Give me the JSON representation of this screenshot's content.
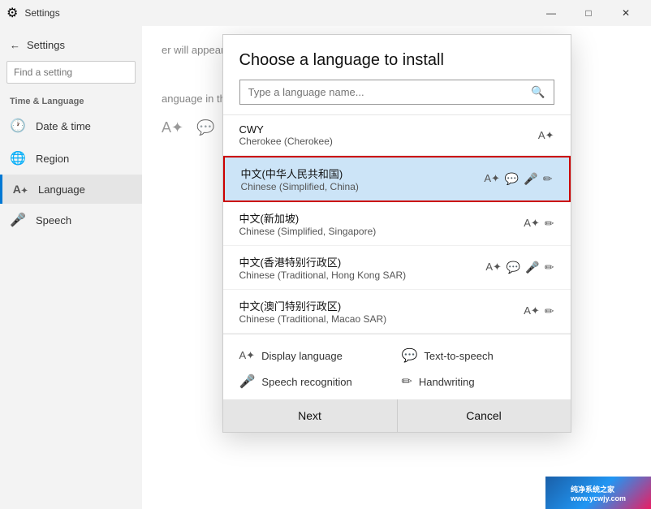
{
  "titleBar": {
    "title": "Settings",
    "minBtn": "—",
    "maxBtn": "□",
    "closeBtn": "✕"
  },
  "sidebar": {
    "backLabel": "Settings",
    "searchPlaceholder": "Find a setting",
    "sectionLabel": "Time & Language",
    "items": [
      {
        "id": "date-time",
        "label": "Date & time",
        "icon": "🕐"
      },
      {
        "id": "region",
        "label": "Region",
        "icon": "🌐"
      },
      {
        "id": "language",
        "label": "Language",
        "icon": "A"
      },
      {
        "id": "speech",
        "label": "Speech",
        "icon": "🎤"
      }
    ]
  },
  "mainContent": {
    "text1": "er will appear in this",
    "text2": "anguage in the list that"
  },
  "dialog": {
    "title": "Choose a language to install",
    "searchPlaceholder": "Type a language name...",
    "languages": [
      {
        "id": "cwy",
        "name": "CWY",
        "subname": "Cherokee (Cherokee)",
        "icons": [
          "🖊"
        ],
        "selected": false
      },
      {
        "id": "zh-cn",
        "name": "中文(中华人民共和国)",
        "subname": "Chinese (Simplified, China)",
        "icons": [
          "🖊",
          "💬",
          "🎤",
          "✏"
        ],
        "selected": true
      },
      {
        "id": "zh-sg",
        "name": "中文(新加坡)",
        "subname": "Chinese (Simplified, Singapore)",
        "icons": [
          "🖊",
          "✏"
        ],
        "selected": false
      },
      {
        "id": "zh-hk",
        "name": "中文(香港特别行政区)",
        "subname": "Chinese (Traditional, Hong Kong SAR)",
        "icons": [
          "🖊",
          "💬",
          "🎤",
          "✏"
        ],
        "selected": false
      },
      {
        "id": "zh-mo",
        "name": "中文(澳门特别行政区)",
        "subname": "Chinese (Traditional, Macao SAR)",
        "icons": [
          "🖊",
          "✏"
        ],
        "selected": false
      }
    ],
    "features": [
      {
        "id": "display",
        "icon": "🖊",
        "label": "Display language"
      },
      {
        "id": "tts",
        "icon": "💬",
        "label": "Text-to-speech"
      },
      {
        "id": "speech",
        "icon": "🎤",
        "label": "Speech recognition"
      },
      {
        "id": "handwriting",
        "icon": "✏",
        "label": "Handwriting"
      }
    ],
    "nextButton": "Next",
    "cancelButton": "Cancel"
  },
  "watermark": {
    "line1": "纯净系统之家",
    "line2": "www.ycwjy.com"
  }
}
